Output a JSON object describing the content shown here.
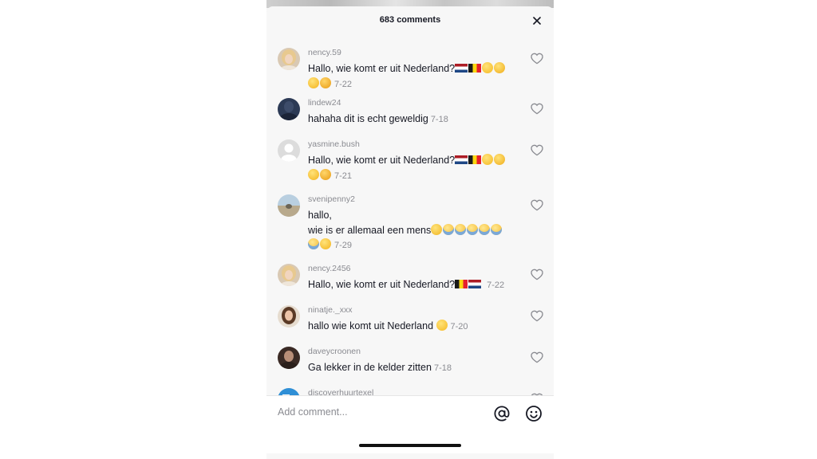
{
  "header": {
    "title": "683 comments",
    "close_icon": "close-icon"
  },
  "comments": [
    {
      "user": "nency.59",
      "line1": "Hallo, wie komt er uit Nederland?",
      "date": "7-22",
      "avatar": "blonde-woman"
    },
    {
      "user": "lindew24",
      "line1": "hahaha dit is echt geweldig",
      "date": "7-18",
      "avatar": "dark-blue"
    },
    {
      "user": "yasmine.bush",
      "line1": "Hallo, wie komt er uit Nederland?",
      "date": "7-21",
      "avatar": "default-grey"
    },
    {
      "user": "svenipenny2",
      "line1": "hallo,",
      "line2": "wie is er allemaal een mens",
      "date": "7-29",
      "avatar": "landscape"
    },
    {
      "user": "nency.2456",
      "line1": "Hallo, wie komt er uit Nederland?",
      "date": "7-22",
      "avatar": "blonde-woman"
    },
    {
      "user": "ninatje._xxx",
      "line1": "hallo wie komt uit Nederland",
      "date": "7-20",
      "avatar": "brunette-woman"
    },
    {
      "user": "daveycroonen",
      "line1": "Ga lekker in de kelder zitten",
      "date": "7-18",
      "avatar": "dark-portrait"
    },
    {
      "user": "discoverhuurtexel",
      "avatar": "blue-logo"
    }
  ],
  "footer": {
    "placeholder": "Add comment...",
    "mention_icon": "at-icon",
    "emoji_icon": "emoji-icon"
  },
  "colors": {
    "sheet_bg": "#f7f7f7",
    "text": "#161823",
    "muted": "#8a8b91"
  }
}
